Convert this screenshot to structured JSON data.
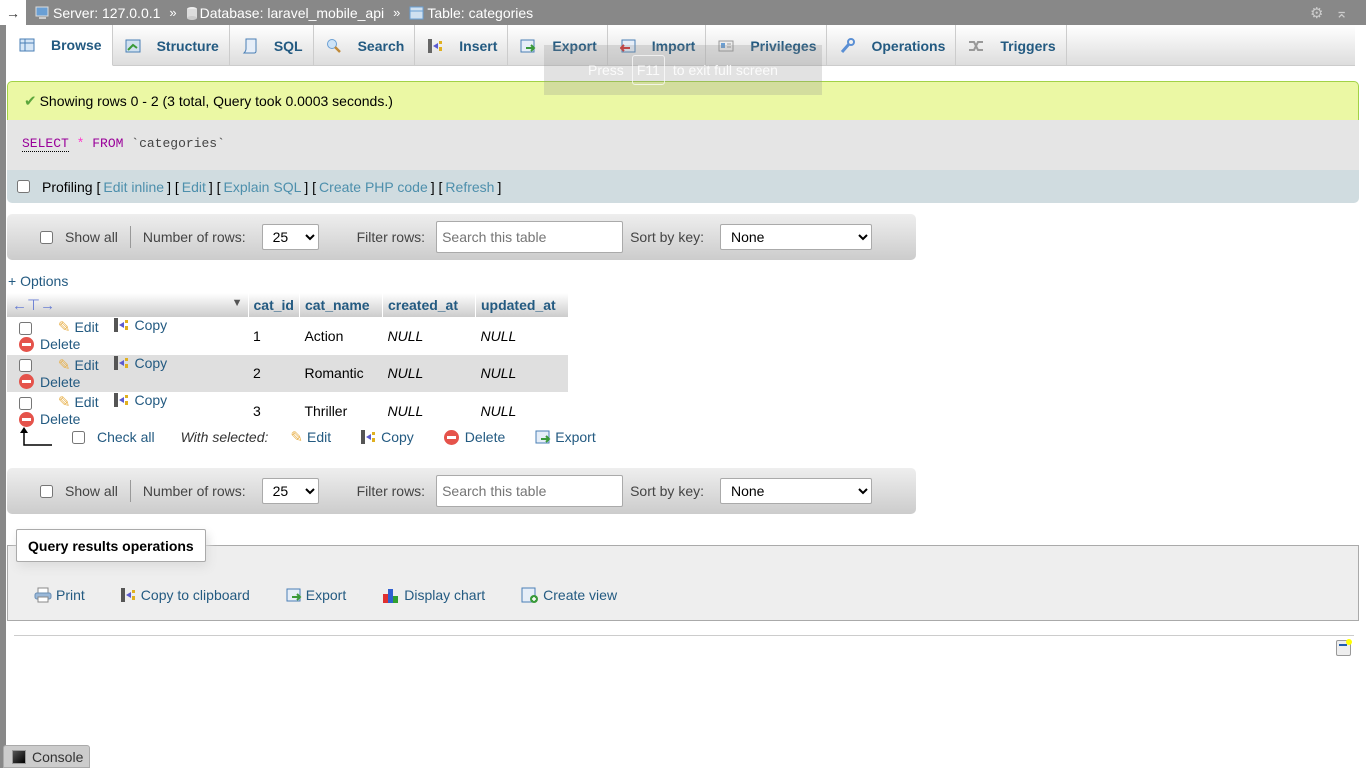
{
  "topbar": {
    "toggle_label": "→",
    "server": "Server: 127.0.0.1",
    "database": "Database: laravel_mobile_api",
    "table": "Table: categories",
    "separator": "»",
    "settings_icon": "gear-icon",
    "collapse_icon": "collapse-up-icon"
  },
  "tabs": [
    {
      "label": "Browse",
      "icon": "browse-icon",
      "active": true
    },
    {
      "label": "Structure",
      "icon": "structure-icon"
    },
    {
      "label": "SQL",
      "icon": "sql-icon"
    },
    {
      "label": "Search",
      "icon": "search-icon"
    },
    {
      "label": "Insert",
      "icon": "insert-icon"
    },
    {
      "label": "Export",
      "icon": "export-icon"
    },
    {
      "label": "Import",
      "icon": "import-icon"
    },
    {
      "label": "Privileges",
      "icon": "privileges-icon"
    },
    {
      "label": "Operations",
      "icon": "wrench-icon"
    },
    {
      "label": "Triggers",
      "icon": "triggers-icon"
    }
  ],
  "fullscreen_notice": {
    "press": "Press",
    "key": "F11",
    "rest": "to exit full screen"
  },
  "success": {
    "message": "Showing rows 0 - 2 (3 total, Query took 0.0003 seconds.)"
  },
  "sql": {
    "select": "SELECT",
    "star": "*",
    "from": "FROM",
    "table": "`categories`"
  },
  "profiling": {
    "label": "Profiling",
    "links": [
      "Edit inline",
      "Edit",
      "Explain SQL",
      "Create PHP code",
      "Refresh"
    ]
  },
  "navbar": {
    "show_all": "Show all",
    "num_rows_label": "Number of rows:",
    "num_rows_value": "25",
    "filter_label": "Filter rows:",
    "filter_placeholder": "Search this table",
    "sort_label": "Sort by key:",
    "sort_value": "None"
  },
  "options_link": "+ Options",
  "table": {
    "columns": [
      "cat_id",
      "cat_name",
      "created_at",
      "updated_at"
    ],
    "row_actions": {
      "edit": "Edit",
      "copy": "Copy",
      "delete": "Delete"
    },
    "rows": [
      {
        "cat_id": "1",
        "cat_name": "Action",
        "created_at": "NULL",
        "updated_at": "NULL"
      },
      {
        "cat_id": "2",
        "cat_name": "Romantic",
        "created_at": "NULL",
        "updated_at": "NULL"
      },
      {
        "cat_id": "3",
        "cat_name": "Thriller",
        "created_at": "NULL",
        "updated_at": "NULL"
      }
    ]
  },
  "with_selected": {
    "check_all": "Check all",
    "label": "With selected:",
    "edit": "Edit",
    "copy": "Copy",
    "delete": "Delete",
    "export": "Export"
  },
  "query_ops": {
    "legend": "Query results operations",
    "links": [
      "Print",
      "Copy to clipboard",
      "Export",
      "Display chart",
      "Create view"
    ]
  },
  "console": {
    "label": "Console"
  }
}
